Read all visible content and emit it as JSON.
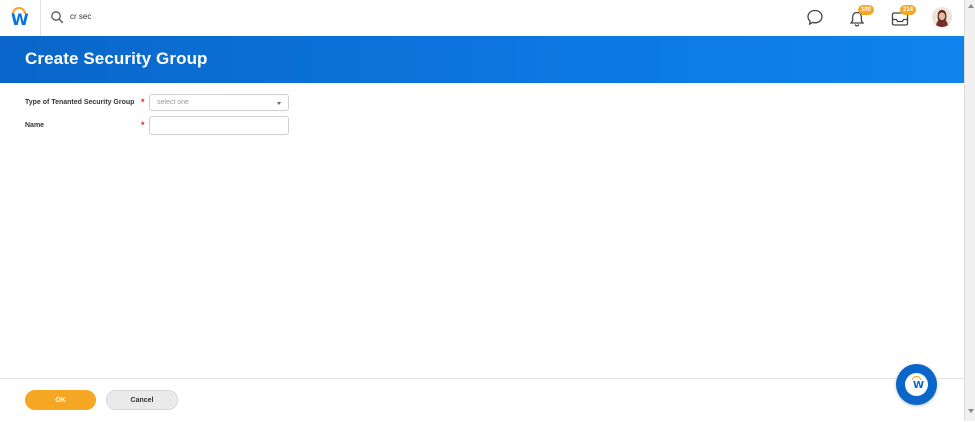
{
  "header": {
    "logo_letter": "W",
    "search": {
      "value": "cr sec"
    },
    "notifications": {
      "count": "100"
    },
    "inbox": {
      "count": "214"
    }
  },
  "page": {
    "title": "Create Security Group"
  },
  "form": {
    "type_field": {
      "label": "Type of Tenanted Security Group",
      "required_mark": "*",
      "placeholder": "select one"
    },
    "name_field": {
      "label": "Name",
      "required_mark": "*",
      "value": ""
    }
  },
  "footer": {
    "ok_label": "OK",
    "cancel_label": "Cancel"
  },
  "assistant": {
    "letter": "W"
  },
  "colors": {
    "brand_blue": "#0c77e0",
    "accent_orange": "#f5a623",
    "required_red": "#d9282f"
  },
  "icons": [
    "workday-logo-icon",
    "search-icon",
    "chat-icon",
    "bell-icon",
    "inbox-icon",
    "avatar",
    "chevron-down-icon",
    "assistant-icon"
  ]
}
